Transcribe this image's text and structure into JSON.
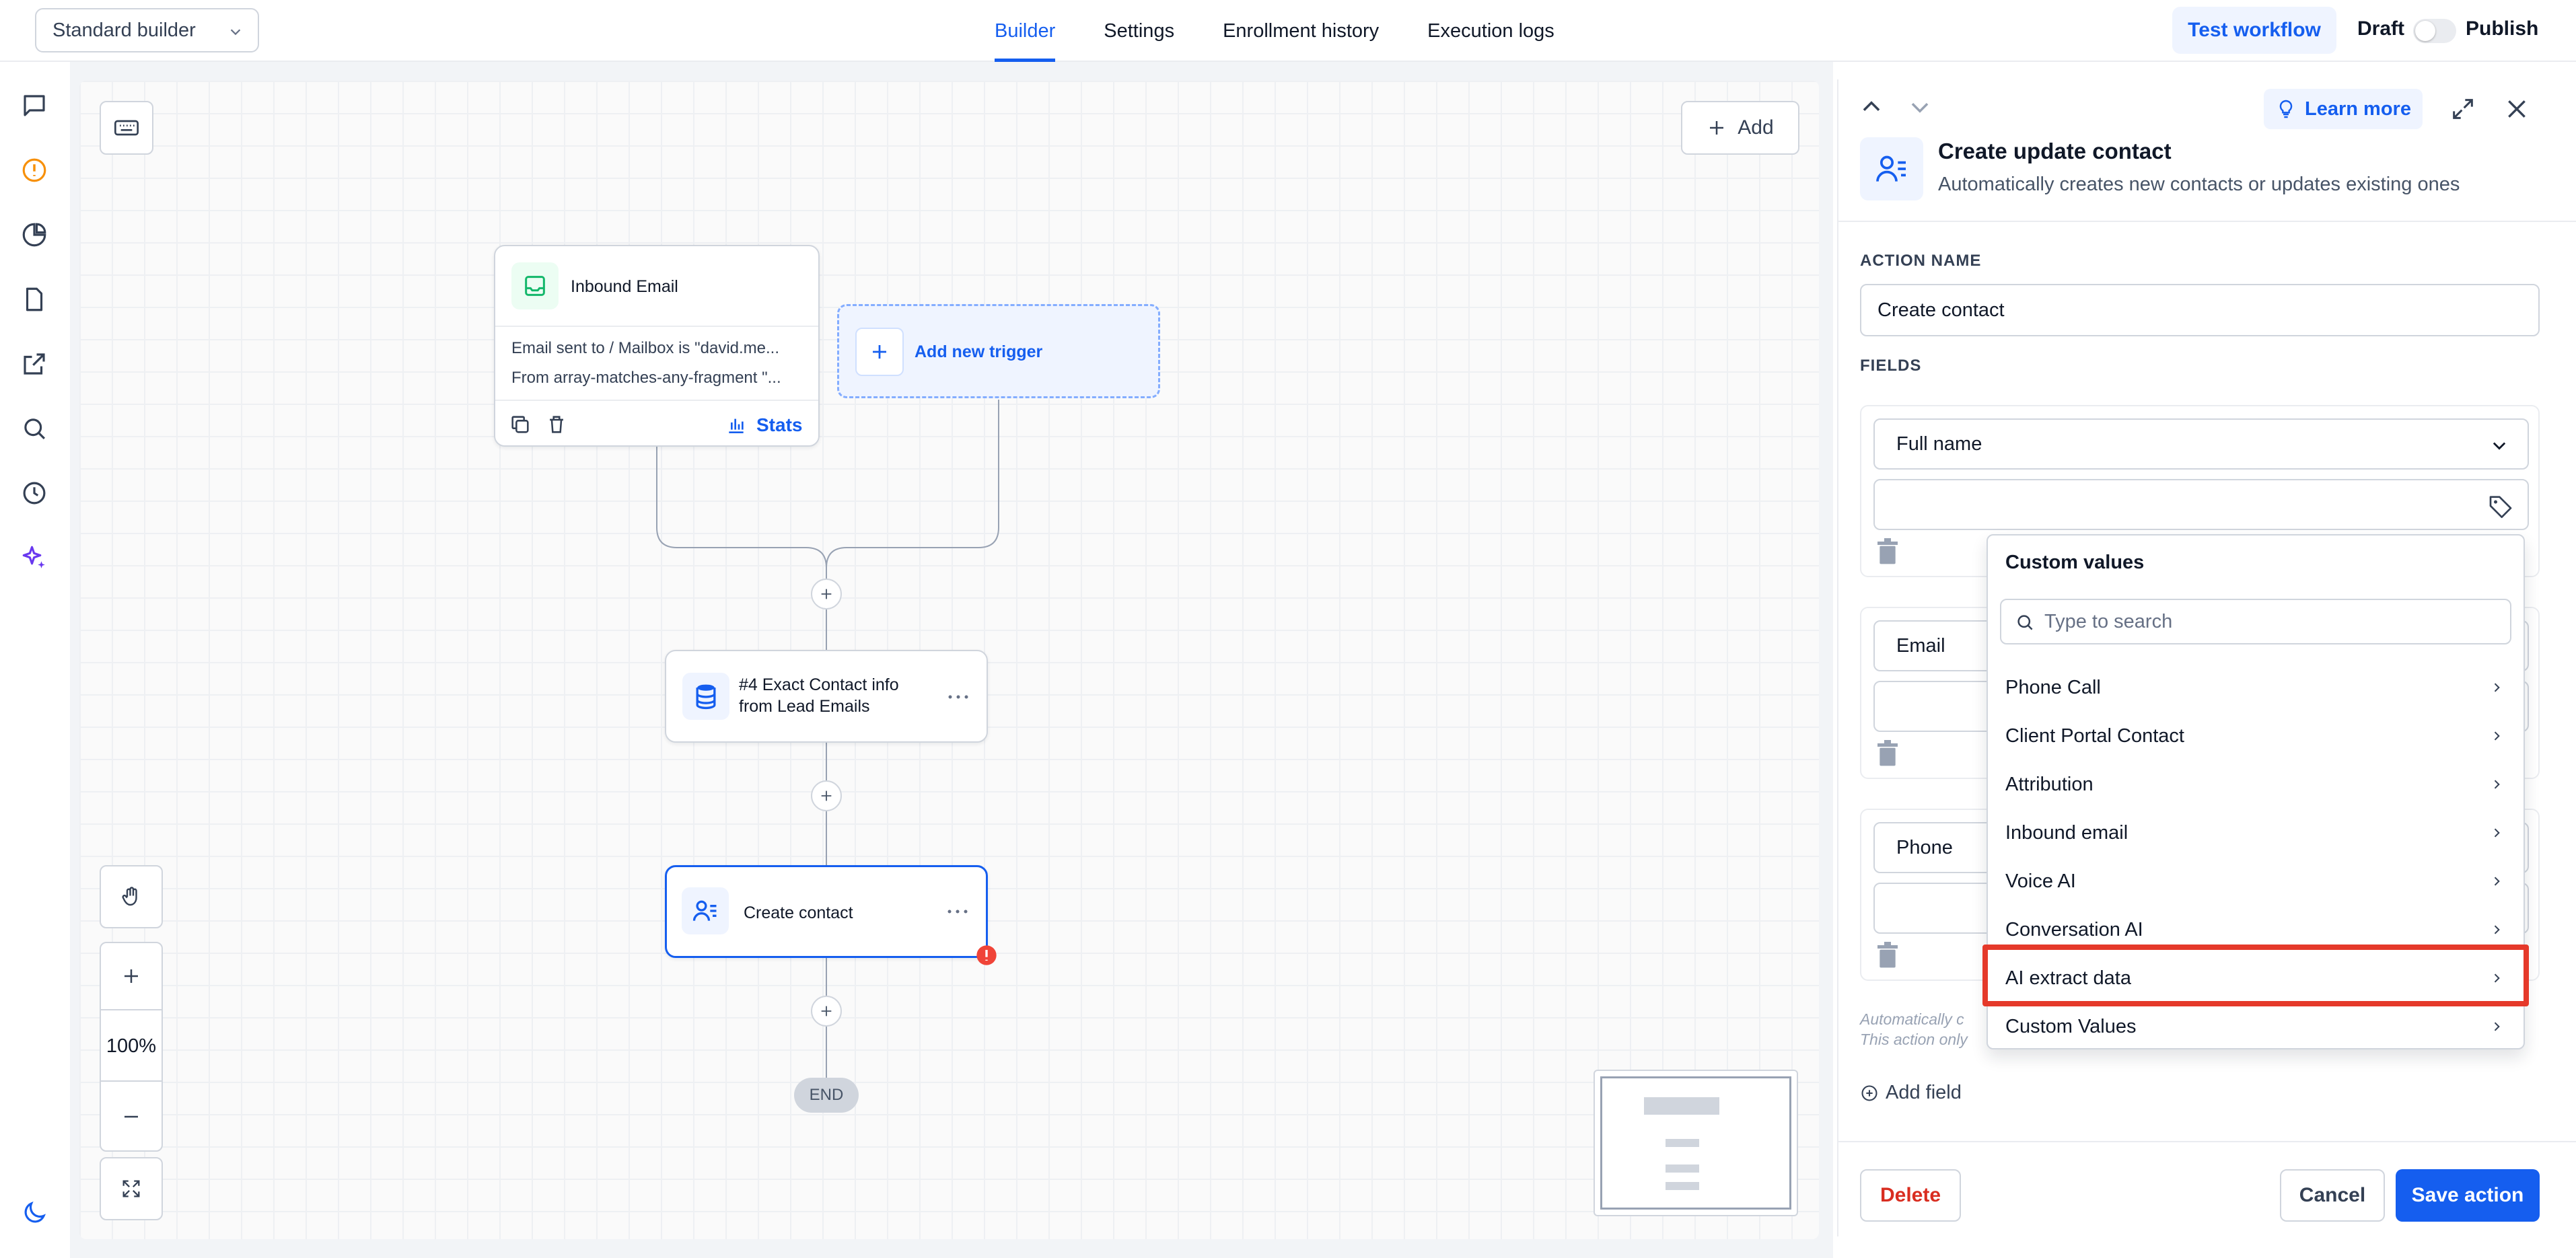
{
  "topbar": {
    "builder_select": "Standard builder",
    "tabs": [
      "Builder",
      "Settings",
      "Enrollment history",
      "Execution logs"
    ],
    "active_tab": "Builder",
    "test_workflow": "Test workflow",
    "draft": "Draft",
    "publish": "Publish"
  },
  "rail": {
    "icons": [
      "chat-icon",
      "alert-icon",
      "pie-chart-icon",
      "document-icon",
      "external-link-icon",
      "search-icon",
      "history-icon",
      "sparkles-icon",
      "moon-icon"
    ]
  },
  "canvas": {
    "add_label": "Add",
    "trigger": {
      "title": "Inbound Email",
      "line1": "Email sent to / Mailbox is \"david.me...",
      "line2": "From array-matches-any-fragment \"...",
      "stats": "Stats"
    },
    "add_trigger": "Add new trigger",
    "action1": {
      "line1": "#4 Exact Contact info",
      "line2": "from Lead Emails"
    },
    "action2": {
      "title": "Create contact"
    },
    "end": "END",
    "zoom": "100%"
  },
  "panel": {
    "learn_more": "Learn more",
    "title": "Create update contact",
    "subtitle": "Automatically creates new contacts or updates existing ones",
    "action_name_label": "ACTION NAME",
    "action_name_value": "Create contact",
    "fields_label": "FIELDS",
    "fields": [
      "Full name",
      "Email",
      "Phone"
    ],
    "note_line1": "Automatically c",
    "note_line2": "This action only",
    "add_field": "Add field",
    "delete": "Delete",
    "cancel": "Cancel",
    "save": "Save action"
  },
  "dropdown": {
    "title": "Custom values",
    "search_placeholder": "Type to search",
    "items": [
      "Phone Call",
      "Client Portal Contact",
      "Attribution",
      "Inbound email",
      "Voice AI",
      "Conversation AI",
      "AI extract data",
      "Custom Values"
    ],
    "highlighted": "AI extract data"
  },
  "colors": {
    "accent": "#155eef",
    "danger": "#d92d20",
    "highlight": "#e5392a",
    "warning": "#f04438"
  }
}
